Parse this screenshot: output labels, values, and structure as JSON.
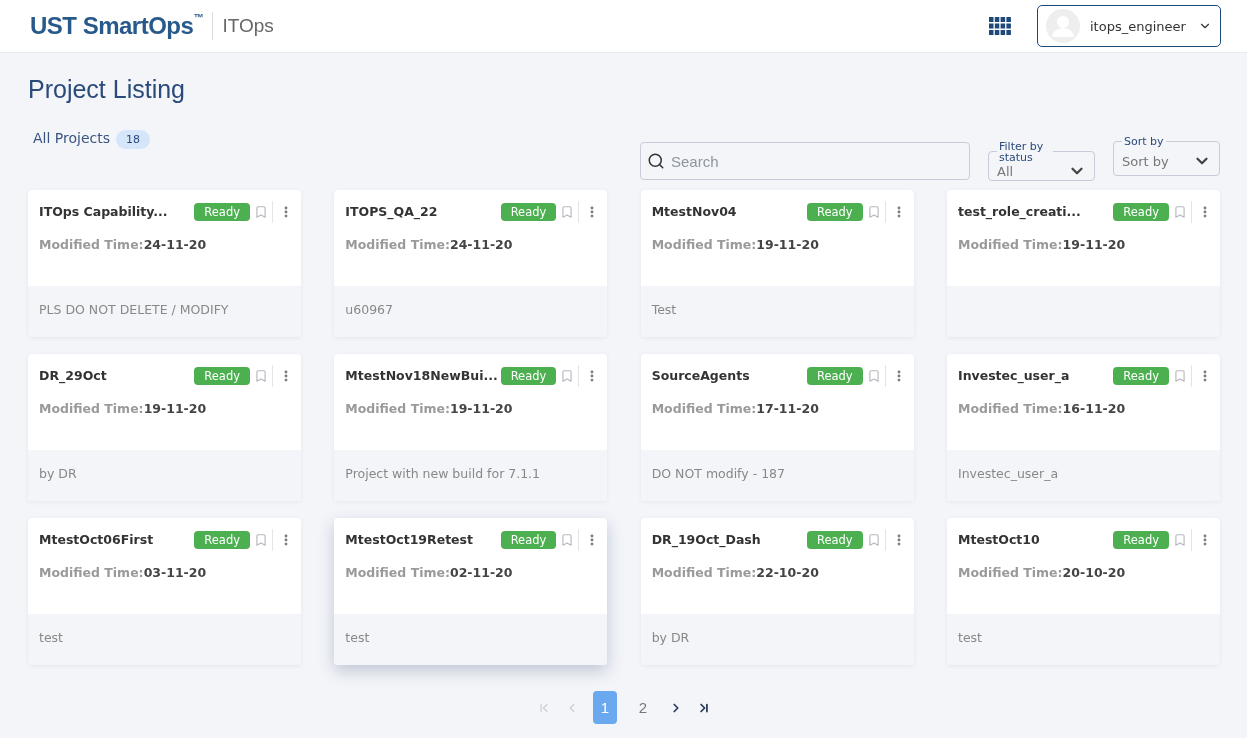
{
  "header": {
    "brand": "UST SmartOps",
    "trademark": "™",
    "product": "ITOps",
    "user": "itops_engineer"
  },
  "page_title": "Project Listing",
  "summary": {
    "label": "All Projects",
    "count": "18"
  },
  "search": {
    "placeholder": "Search"
  },
  "filter": {
    "label": "Filter by status",
    "value": "All"
  },
  "sort": {
    "label": "Sort by",
    "value": "Sort by"
  },
  "projects": [
    {
      "name": "ITOps Capability...",
      "status": "Ready",
      "time_label": "Modified Time:",
      "time": "24-11-20",
      "description": "PLS DO NOT DELETE / MODIFY",
      "raised": false
    },
    {
      "name": "ITOPS_QA_22",
      "status": "Ready",
      "time_label": "Modified Time:",
      "time": "24-11-20",
      "description": "u60967",
      "raised": false
    },
    {
      "name": "MtestNov04",
      "status": "Ready",
      "time_label": "Modified Time:",
      "time": "19-11-20",
      "description": "Test",
      "raised": false
    },
    {
      "name": "test_role_creati...",
      "status": "Ready",
      "time_label": "Modified Time:",
      "time": "19-11-20",
      "raised": false
    },
    {
      "name": "DR_29Oct",
      "status": "Ready",
      "time_label": "Modified Time:",
      "time": "19-11-20",
      "description": "by DR",
      "raised": false
    },
    {
      "name": "MtestNov18NewBui...",
      "status": "Ready",
      "time_label": "Modified Time:",
      "time": "19-11-20",
      "description": "Project with new build for 7.1.1",
      "raised": false
    },
    {
      "name": "SourceAgents",
      "status": "Ready",
      "time_label": "Modified Time:",
      "time": "17-11-20",
      "description": "DO NOT modify - 187",
      "raised": false
    },
    {
      "name": "Investec_user_a",
      "status": "Ready",
      "time_label": "Modified Time:",
      "time": "16-11-20",
      "description": "Investec_user_a",
      "raised": false
    },
    {
      "name": "MtestOct06First",
      "status": "Ready",
      "time_label": "Modified Time:",
      "time": "03-11-20",
      "description": "test",
      "raised": false
    },
    {
      "name": "MtestOct19Retest",
      "status": "Ready",
      "time_label": "Modified Time:",
      "time": "02-11-20",
      "description": "test",
      "raised": true
    },
    {
      "name": "DR_19Oct_Dash",
      "status": "Ready",
      "time_label": "Modified Time:",
      "time": "22-10-20",
      "description": "by DR",
      "raised": false
    },
    {
      "name": "MtestOct10",
      "status": "Ready",
      "time_label": "Modified Time:",
      "time": "20-10-20",
      "description": "test",
      "raised": false
    }
  ],
  "pagination": {
    "first_disabled": true,
    "prev_disabled": true,
    "pages": [
      {
        "label": "1",
        "selected": true
      },
      {
        "label": "2",
        "selected": false
      }
    ],
    "next_disabled": false,
    "last_disabled": false
  }
}
